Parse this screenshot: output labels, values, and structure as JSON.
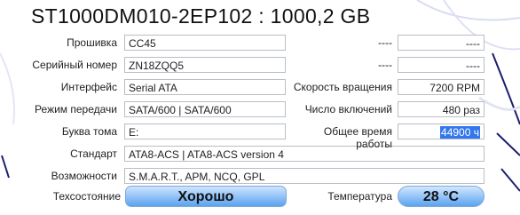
{
  "title": "ST1000DM010-2EP102 : 1000,2 GB",
  "fields": {
    "firmware": {
      "label": "Прошивка",
      "value": "CC45"
    },
    "serial": {
      "label": "Серийный номер",
      "value": "ZN18ZQQ5"
    },
    "interface": {
      "label": "Интерфейс",
      "value": "Serial ATA"
    },
    "transfer": {
      "label": "Режим передачи",
      "value": "SATA/600 | SATA/600"
    },
    "drive_letter": {
      "label": "Буква тома",
      "value": "E:"
    },
    "standard": {
      "label": "Стандарт",
      "value": "ATA8-ACS | ATA8-ACS version 4"
    },
    "features": {
      "label": "Возможности",
      "value": "S.M.A.R.T., APM, NCQ, GPL"
    }
  },
  "right_fields": {
    "top1": {
      "label": "----",
      "value": "----"
    },
    "top2": {
      "label": "----",
      "value": "----"
    },
    "rotation": {
      "label": "Скорость вращения",
      "value": "7200 RPM"
    },
    "power_count": {
      "label": "Число включений",
      "value": "480 раз"
    },
    "power_hours": {
      "label": "Общее время работы",
      "value": "44900 ч"
    }
  },
  "status": {
    "label": "Техсостояние",
    "value": "Хорошо"
  },
  "temperature": {
    "label": "Температура",
    "value": "28 °C"
  },
  "colors": {
    "good_badge": "#5aa3ef",
    "selection": "#3377ee"
  }
}
